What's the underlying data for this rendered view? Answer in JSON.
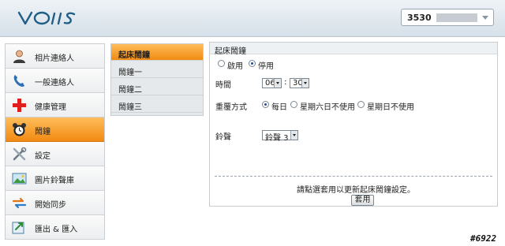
{
  "device": {
    "selected": "3530"
  },
  "sidebar": {
    "items": [
      {
        "label": "相片連絡人",
        "icon": "contact-photo-icon"
      },
      {
        "label": "一般連絡人",
        "icon": "phone-icon"
      },
      {
        "label": "健康管理",
        "icon": "health-cross-icon"
      },
      {
        "label": "鬧鐘",
        "icon": "alarm-clock-icon",
        "active": true
      },
      {
        "label": "設定",
        "icon": "tools-icon"
      },
      {
        "label": "圖片鈴聲庫",
        "icon": "picture-icon"
      },
      {
        "label": "開始同步",
        "icon": "sync-icon"
      },
      {
        "label": "匯出 & 匯入",
        "icon": "export-import-icon"
      }
    ]
  },
  "subnav": {
    "items": [
      {
        "label": "起床鬧鐘",
        "active": true
      },
      {
        "label": "鬧鐘一"
      },
      {
        "label": "鬧鐘二"
      },
      {
        "label": "鬧鐘三"
      }
    ]
  },
  "panel": {
    "title": "起床鬧鐘",
    "enable_label": "啟用",
    "disable_label": "停用",
    "enabled": false,
    "time_label": "時間",
    "hour": "06",
    "minute": "30",
    "time_separator": ":",
    "repeat_label": "重覆方式",
    "repeat_options": [
      "每日",
      "星期六日不使用",
      "星期日不使用"
    ],
    "repeat_selected": "每日",
    "ringtone_label": "鈴聲",
    "ringtone": "鈴聲 3",
    "hint": "請點選套用以更新起床鬧鐘設定。",
    "apply_label": "套用"
  },
  "corner_tag": "#6922",
  "colors": {
    "accent": "#f28a12",
    "header": "#dde6ed"
  }
}
